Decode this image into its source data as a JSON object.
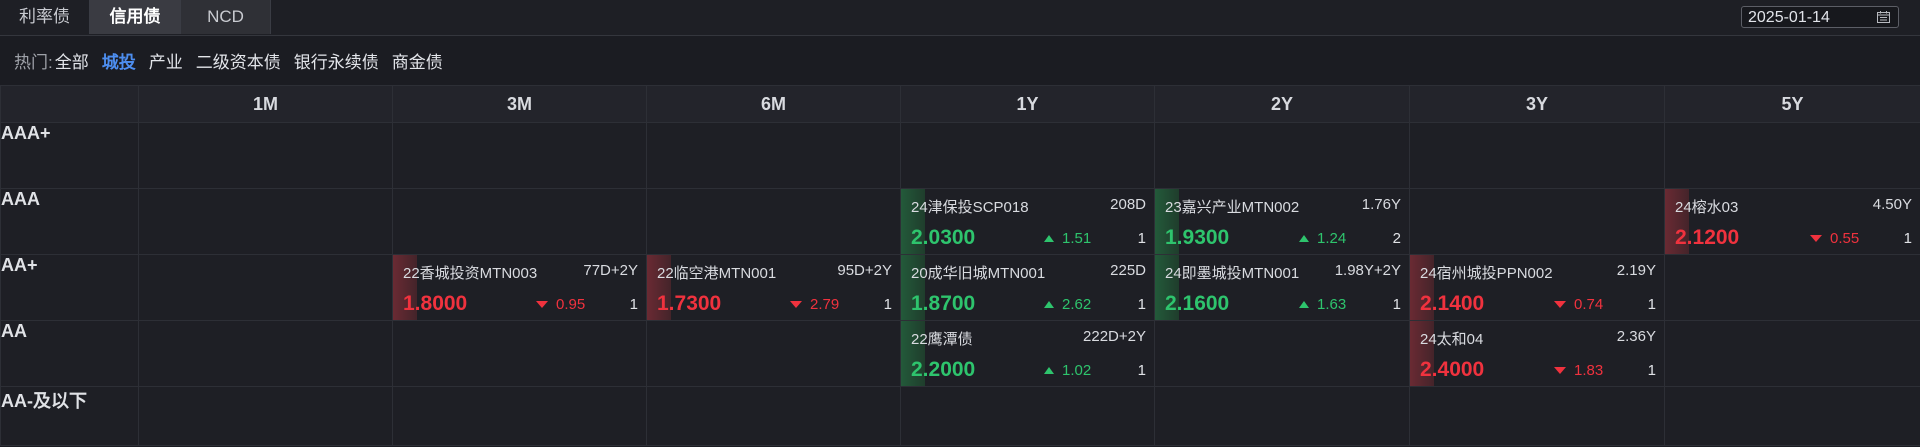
{
  "tabs": [
    "利率债",
    "信用债",
    "NCD"
  ],
  "date": "2025-01-14",
  "hot": {
    "label": "热门:",
    "items": [
      "全部",
      "城投",
      "产业",
      "二级资本债",
      "银行永续债",
      "商金债"
    ],
    "active": "城投"
  },
  "colors": {
    "up": "#2ec46d",
    "down": "#f0323e",
    "active": "#4d8ef0"
  },
  "terms": [
    "1M",
    "3M",
    "6M",
    "1Y",
    "2Y",
    "3Y",
    "5Y"
  ],
  "ratings": [
    "AAA+",
    "AAA",
    "AA+",
    "AA",
    "AA-及以下"
  ],
  "rows": [
    {
      "cells": [
        null,
        null,
        null,
        null,
        null,
        null,
        null
      ]
    },
    {
      "cells": [
        null,
        null,
        null,
        {
          "name": "24津保投SCP018",
          "term": "208D",
          "rate": "2.0300",
          "dir": "up",
          "chg": "1.51",
          "cnt": "1"
        },
        {
          "name": "23嘉兴产业MTN002",
          "term": "1.76Y",
          "rate": "1.9300",
          "dir": "up",
          "chg": "1.24",
          "cnt": "2"
        },
        null,
        {
          "name": "24榕水03",
          "term": "4.50Y",
          "rate": "2.1200",
          "dir": "down",
          "chg": "0.55",
          "cnt": "1"
        }
      ]
    },
    {
      "cells": [
        null,
        {
          "name": "22香城投资MTN003",
          "term": "77D+2Y",
          "rate": "1.8000",
          "dir": "down",
          "chg": "0.95",
          "cnt": "1"
        },
        {
          "name": "22临空港MTN001",
          "term": "95D+2Y",
          "rate": "1.7300",
          "dir": "down",
          "chg": "2.79",
          "cnt": "1"
        },
        {
          "name": "20成华旧城MTN001",
          "term": "225D",
          "rate": "1.8700",
          "dir": "up",
          "chg": "2.62",
          "cnt": "1"
        },
        {
          "name": "24即墨城投MTN001",
          "term": "1.98Y+2Y",
          "rate": "2.1600",
          "dir": "up",
          "chg": "1.63",
          "cnt": "1"
        },
        {
          "name": "24宿州城投PPN002",
          "term": "2.19Y",
          "rate": "2.1400",
          "dir": "down",
          "chg": "0.74",
          "cnt": "1"
        },
        null
      ]
    },
    {
      "cells": [
        null,
        null,
        null,
        {
          "name": "22鹰潭债",
          "term": "222D+2Y",
          "rate": "2.2000",
          "dir": "up",
          "chg": "1.02",
          "cnt": "1"
        },
        null,
        {
          "name": "24太和04",
          "term": "2.36Y",
          "rate": "2.4000",
          "dir": "down",
          "chg": "1.83",
          "cnt": "1"
        },
        null
      ]
    },
    {
      "cells": [
        null,
        null,
        null,
        null,
        null,
        null,
        null
      ]
    }
  ]
}
